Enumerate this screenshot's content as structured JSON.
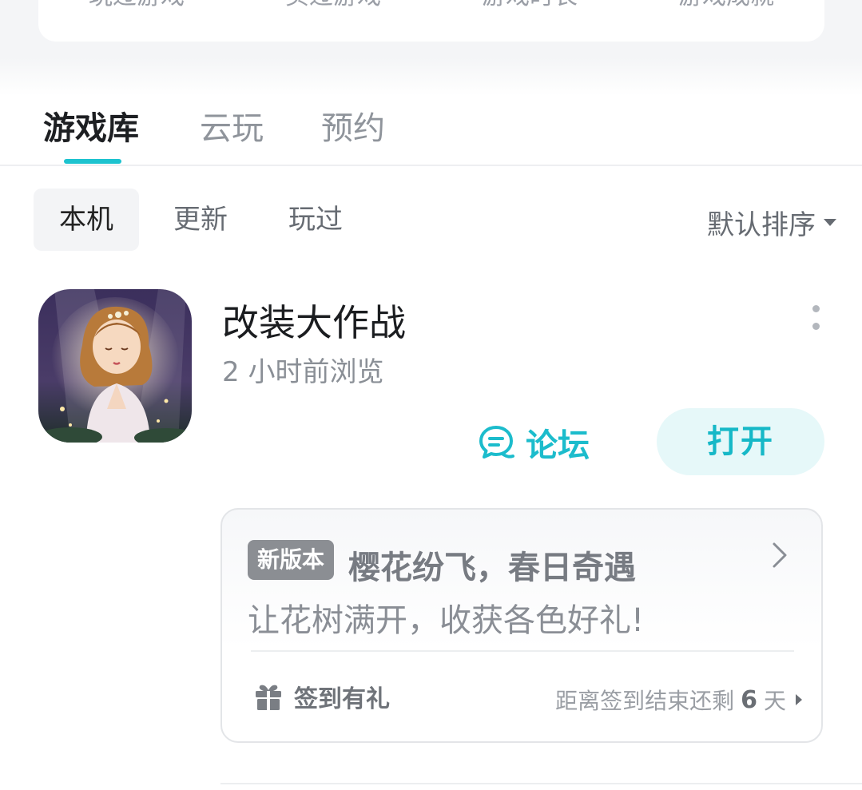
{
  "stats": {
    "labels": [
      "玩过游戏",
      "买过游戏",
      "游戏时长",
      "游戏成就"
    ]
  },
  "main_tabs": [
    {
      "label": "游戏库",
      "active": true
    },
    {
      "label": "云玩",
      "active": false
    },
    {
      "label": "预约",
      "active": false
    }
  ],
  "sub_tabs": [
    {
      "label": "本机",
      "active": true
    },
    {
      "label": "更新",
      "active": false
    },
    {
      "label": "玩过",
      "active": false
    }
  ],
  "sort": {
    "label": "默认排序",
    "icon": "caret-down-icon"
  },
  "game": {
    "title": "改装大作战",
    "subtitle": "2 小时前浏览",
    "forum_label": "论坛",
    "open_label": "打开"
  },
  "promo": {
    "badge": "新版本",
    "title": "樱花纷飞，春日奇遇",
    "desc": "让花树满开，收获各色好礼!",
    "gift_label": "签到有礼",
    "countdown_prefix": "距离签到结束还剩",
    "countdown_num": "6",
    "countdown_suffix": "天"
  },
  "colors": {
    "accent": "#1dc3cf",
    "open_bg": "#e6f8f9",
    "badge_bg": "#8b8e93"
  }
}
